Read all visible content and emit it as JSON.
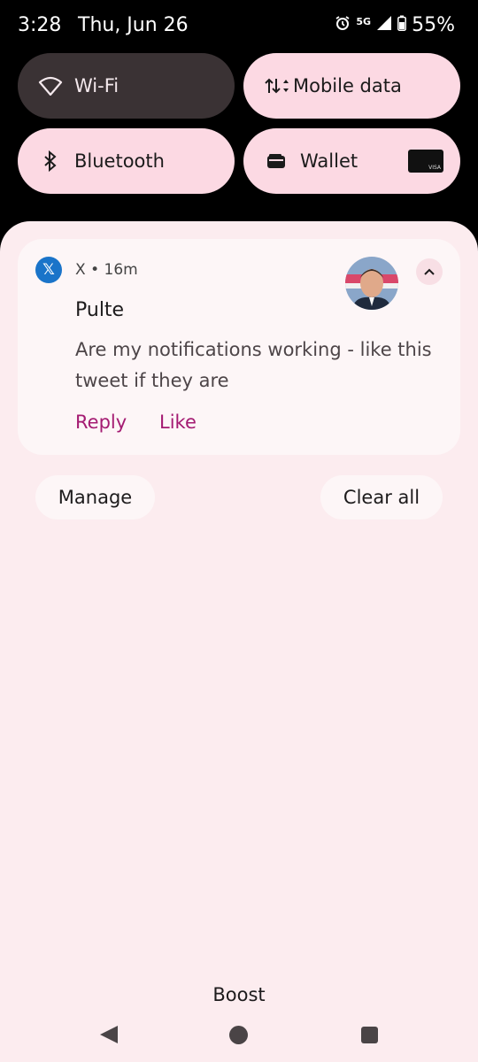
{
  "status_bar": {
    "time": "3:28",
    "date": "Thu, Jun 26",
    "network": "5G",
    "battery": "55%"
  },
  "quick_settings": {
    "tiles": [
      {
        "label": "Wi-Fi",
        "icon": "wifi-icon",
        "state": "off"
      },
      {
        "label": "Mobile data",
        "icon": "mobile-data-icon",
        "state": "on"
      },
      {
        "label": "Bluetooth",
        "icon": "bluetooth-icon",
        "state": "on"
      },
      {
        "label": "Wallet",
        "icon": "wallet-icon",
        "state": "on"
      }
    ],
    "wallet_card_brand": "VISA"
  },
  "notification": {
    "app_name": "X",
    "time_ago": "16m",
    "title": "Pulte",
    "body": "Are my notifications working - like this tweet if they are",
    "actions": [
      "Reply",
      "Like"
    ],
    "app_icon": "x-logo-icon",
    "accent_color": "#a41b72"
  },
  "buttons": {
    "manage": "Manage",
    "clear_all": "Clear all"
  },
  "carrier": "Boost",
  "colors": {
    "tile_bg": "#fcd9e3",
    "tile_off_bg": "#3a3234",
    "sheet_bg": "#fcecef",
    "card_bg": "#fdf6f7"
  }
}
